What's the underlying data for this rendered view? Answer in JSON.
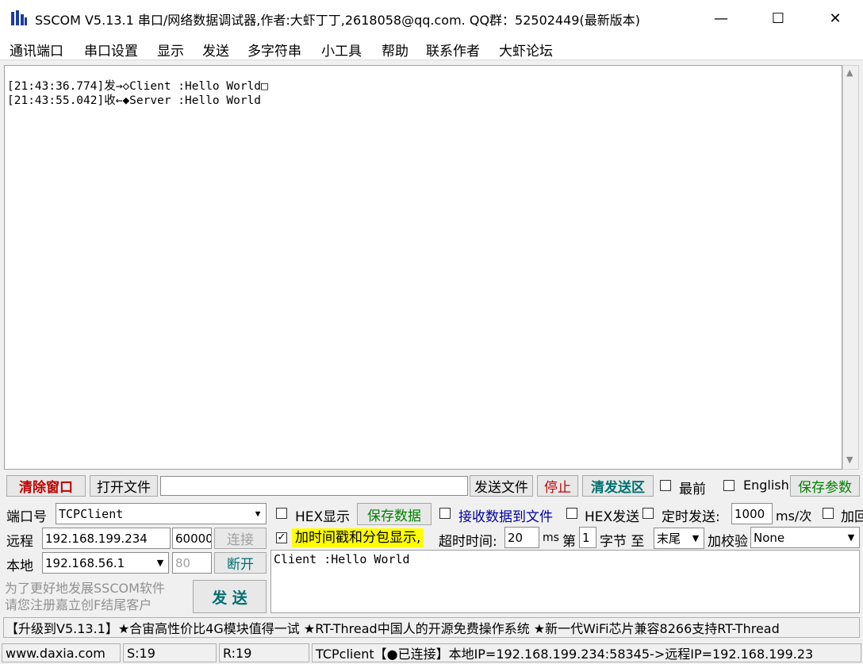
{
  "window": {
    "title": "SSCOM V5.13.1 串口/网络数据调试器,作者:大虾丁丁,2618058@qq.com. QQ群：52502449(最新版本)",
    "minimize": "—",
    "maximize": "☐",
    "close": "✕"
  },
  "menu": [
    "通讯端口",
    "串口设置",
    "显示",
    "发送",
    "多字符串",
    "小工具",
    "帮助",
    "联系作者",
    "大虾论坛"
  ],
  "output": {
    "lines": [
      "[21:43:36.774]发→◇Client :Hello World□",
      "[21:43:55.042]收←◆Server :Hello World"
    ]
  },
  "toolbar": {
    "clear_window": "清除窗口",
    "open_file": "打开文件",
    "file_path": "",
    "send_file": "发送文件",
    "stop": "停止",
    "clear_send": "清发送区",
    "topmost": "最前",
    "english": "English",
    "save_params": "保存参数"
  },
  "port": {
    "port_label": "端口号",
    "port_value": "TCPClient",
    "remote_label": "远程",
    "remote_ip": "192.168.199.234",
    "remote_port": "60000",
    "connect": "连接",
    "local_label": "本地",
    "local_ip": "192.168.56.1",
    "local_port": "80",
    "disconnect": "断开"
  },
  "options": {
    "hex_display": "HEX显示",
    "save_data": "保存数据",
    "recv_to_file": "接收数据到文件",
    "hex_send": "HEX发送",
    "timed_send": "定时发送:",
    "interval": "1000",
    "interval_unit": "ms/次",
    "add_crlf": "加回",
    "timestamp": "加时间戳和分包显示,",
    "timeout_label": "超时时间:",
    "timeout_value": "20",
    "timeout_unit": "ms",
    "byte_prefix": "第",
    "byte_index": "1",
    "byte_suffix": "字节 至",
    "byte_end": "末尾",
    "checksum_label": "加校验",
    "checksum_value": "None"
  },
  "send": {
    "text": "Client :Hello World",
    "promo": "为了更好地发展SSCOM软件\n请您注册嘉立创F结尾客户",
    "send_button": "发  送"
  },
  "ad": "【升级到V5.13.1】★合宙高性价比4G模块值得一试 ★RT-Thread中国人的开源免费操作系统 ★新一代WiFi芯片兼容8266支持RT-Thread",
  "status": {
    "site": "www.daxia.com",
    "sent": "S:19",
    "recv": "R:19",
    "conn": "TCPclient【●已连接】本地IP=192.168.199.234:58345->远程IP=192.168.199.23"
  },
  "colors": {
    "red_text": "#c00000",
    "green_text": "#008000",
    "teal_text": "#007070",
    "blue_text": "#0000a0",
    "highlight": "#ffff00"
  }
}
